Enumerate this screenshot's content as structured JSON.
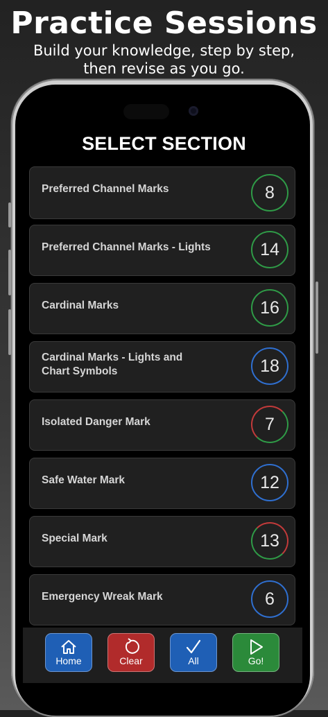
{
  "promo": {
    "title": "Practice Sessions",
    "subtitle": "Build your knowledge, step by step, then revise as you go."
  },
  "screen": {
    "title": "SELECT SECTION"
  },
  "colors": {
    "green": "#2f9b47",
    "blue": "#2f6fd0",
    "red": "#c23a3a",
    "home_button": "#1f5fb5",
    "clear_button": "#b12b2b",
    "all_button": "#1f5fb5",
    "go_button": "#2b8a3a"
  },
  "sections": [
    {
      "label": "Preferred Channel Marks",
      "count": "8",
      "badge_color": "green"
    },
    {
      "label": "Preferred Channel Marks - Lights",
      "count": "14",
      "badge_color": "green"
    },
    {
      "label": "Cardinal Marks",
      "count": "16",
      "badge_color": "green"
    },
    {
      "label": "Cardinal Marks - Lights and Chart Symbols",
      "count": "18",
      "badge_color": "blue"
    },
    {
      "label": "Isolated Danger Mark",
      "count": "7",
      "badge_color": "red-green"
    },
    {
      "label": "Safe Water Mark",
      "count": "12",
      "badge_color": "blue"
    },
    {
      "label": "Special Mark",
      "count": "13",
      "badge_color": "red-green"
    },
    {
      "label": "Emergency Wreak Mark",
      "count": "6",
      "badge_color": "blue"
    }
  ],
  "toolbar": {
    "home": {
      "label": "Home",
      "icon": "house-icon"
    },
    "clear": {
      "label": "Clear",
      "icon": "refresh-icon"
    },
    "all": {
      "label": "All",
      "icon": "checkmark-icon"
    },
    "go": {
      "label": "Go!",
      "icon": "play-icon"
    }
  }
}
